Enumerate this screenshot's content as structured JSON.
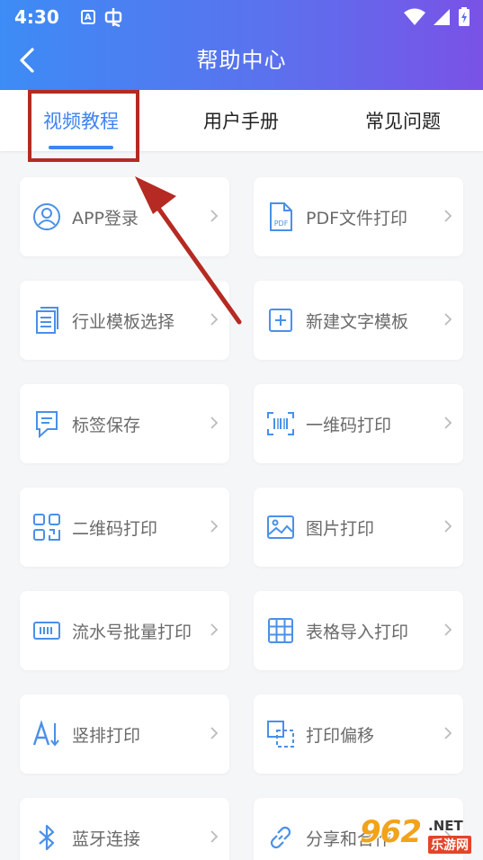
{
  "status_bar": {
    "time": "4:30",
    "a_icon": "A"
  },
  "header": {
    "title": "帮助中心",
    "back_icon": "chevron-left-icon"
  },
  "tabs": [
    {
      "label": "视频教程",
      "active": true
    },
    {
      "label": "用户手册",
      "active": false
    },
    {
      "label": "常见问题",
      "active": false
    }
  ],
  "items": [
    {
      "label": "APP登录",
      "icon": "user-circle-icon"
    },
    {
      "label": "PDF文件打印",
      "icon": "pdf-file-icon"
    },
    {
      "label": "行业模板选择",
      "icon": "template-stack-icon"
    },
    {
      "label": "新建文字模板",
      "icon": "add-box-icon"
    },
    {
      "label": "标签保存",
      "icon": "label-save-icon"
    },
    {
      "label": "一维码打印",
      "icon": "barcode-icon"
    },
    {
      "label": "二维码打印",
      "icon": "qrcode-icon"
    },
    {
      "label": "图片打印",
      "icon": "image-icon"
    },
    {
      "label": "流水号批量打印",
      "icon": "serial-number-icon"
    },
    {
      "label": "表格导入打印",
      "icon": "table-grid-icon"
    },
    {
      "label": "竖排打印",
      "icon": "vertical-text-icon"
    },
    {
      "label": "打印偏移",
      "icon": "offset-icon"
    },
    {
      "label": "蓝牙连接",
      "icon": "bluetooth-icon"
    },
    {
      "label": "分享和合作",
      "icon": "link-icon"
    }
  ],
  "colors": {
    "accent": "#3e84f3",
    "highlight": "#b52a22",
    "header_start": "#3d8cf5",
    "header_end": "#7a52e6"
  },
  "watermark": {
    "number": "962",
    "net": ".NET",
    "cn": "乐游网"
  }
}
